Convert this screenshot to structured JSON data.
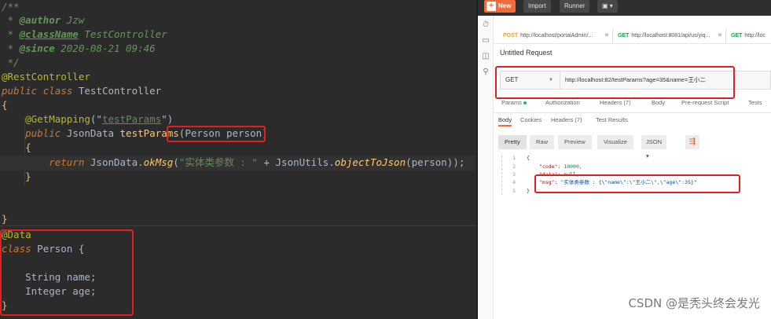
{
  "editor": {
    "lines": [
      {
        "text": "/**"
      },
      {
        "text": " * @author Jzw"
      },
      {
        "text": " * @className TestController"
      },
      {
        "text": " * @since 2020-08-21 09:46"
      },
      {
        "text": " */"
      },
      {
        "text": "@RestController"
      },
      {
        "text": "public class TestController"
      },
      {
        "text": "{"
      },
      {
        "text": "    @GetMapping(\"testParams\")"
      },
      {
        "text": "    public JsonData testParams(Person person)"
      },
      {
        "text": "    {"
      },
      {
        "text": "        return JsonData.okMsg(\"实体类参数 : \" + JsonUtils.objectToJson(person));"
      },
      {
        "text": "    }"
      },
      {
        "text": "}"
      },
      {
        "text": "@Data"
      },
      {
        "text": "class Person {"
      },
      {
        "text": "    String name;"
      },
      {
        "text": "    Integer age;"
      },
      {
        "text": "}"
      }
    ],
    "tokens": {
      "comment_open": "/**",
      "star": " * ",
      "author_tag": "@author",
      "author_val": " Jzw",
      "classname_tag": "@className",
      "classname_val": " TestController",
      "since_tag": "@since",
      "since_val": " 2020-08-21 09:46",
      "comment_close": " */",
      "rest_ann": "@RestController",
      "kw_public": "public",
      "kw_class": "class",
      "class_name": " TestController",
      "brace_open": "{",
      "brace_close": "}",
      "getmapping": "@GetMapping",
      "getmapping_open": "(\"",
      "getmapping_str": "testParams",
      "getmapping_close": "\")",
      "return_type": " JsonData ",
      "method_name": "testParams",
      "param": "(Person person)",
      "kw_return": "return",
      "ret_class": " JsonData.",
      "okmsg": "okMsg",
      "okmsg_arg_open": "(",
      "okmsg_str": "\"实体类参数 : \"",
      "plus": " + JsonUtils.",
      "to_json": "objectToJson",
      "to_json_arg": "(person));",
      "data_ann": "@Data",
      "class_kw": "class",
      "person_decl": " Person {",
      "field_name": "    String name;",
      "field_age": "    Integer age;"
    }
  },
  "postman": {
    "toolbar": {
      "new_label": "New",
      "import_label": "Import",
      "runner_label": "Runner",
      "more_caret": "▾"
    },
    "tabs": [
      {
        "method": "POST",
        "url": "http://localhost/portalAdmin/..."
      },
      {
        "method": "GET",
        "url": "http://localhost:8081/api/us/yiq..."
      },
      {
        "method": "GET",
        "url": "http://loc"
      }
    ],
    "request_title": "Untitled Request",
    "method": "GET",
    "url": "http://localhost:82/testParams?age=35&name=王小二",
    "request_tabs": [
      "Params",
      "Authorization",
      "Headers (7)",
      "Body",
      "Pre-request Script",
      "Tests"
    ],
    "response_tabs": [
      "Body",
      "Cookies",
      "Headers (7)",
      "Test Results"
    ],
    "response_headers_count": "(7)",
    "format_buttons": [
      "Pretty",
      "Raw",
      "Preview",
      "Visualize"
    ],
    "format_select": "JSON",
    "response_lines": [
      {
        "num": "1",
        "text": "{"
      },
      {
        "num": "2",
        "key": "\"code\"",
        "value": " 10000,"
      },
      {
        "num": "3",
        "key": "\"data\"",
        "value": " null,"
      },
      {
        "num": "4",
        "key": "\"msg\"",
        "value": " \"实体类参数 : {\\\"name\\\":\\\"王小二\\\",\\\"age\\\":35}\""
      },
      {
        "num": "5",
        "text": "}"
      }
    ],
    "watermark": "CSDN @是秃头终会发光"
  },
  "colors": {
    "highlight_box": "#e02020",
    "postman_orange": "#f26b3a",
    "editor_bg": "#2b2b2b"
  }
}
